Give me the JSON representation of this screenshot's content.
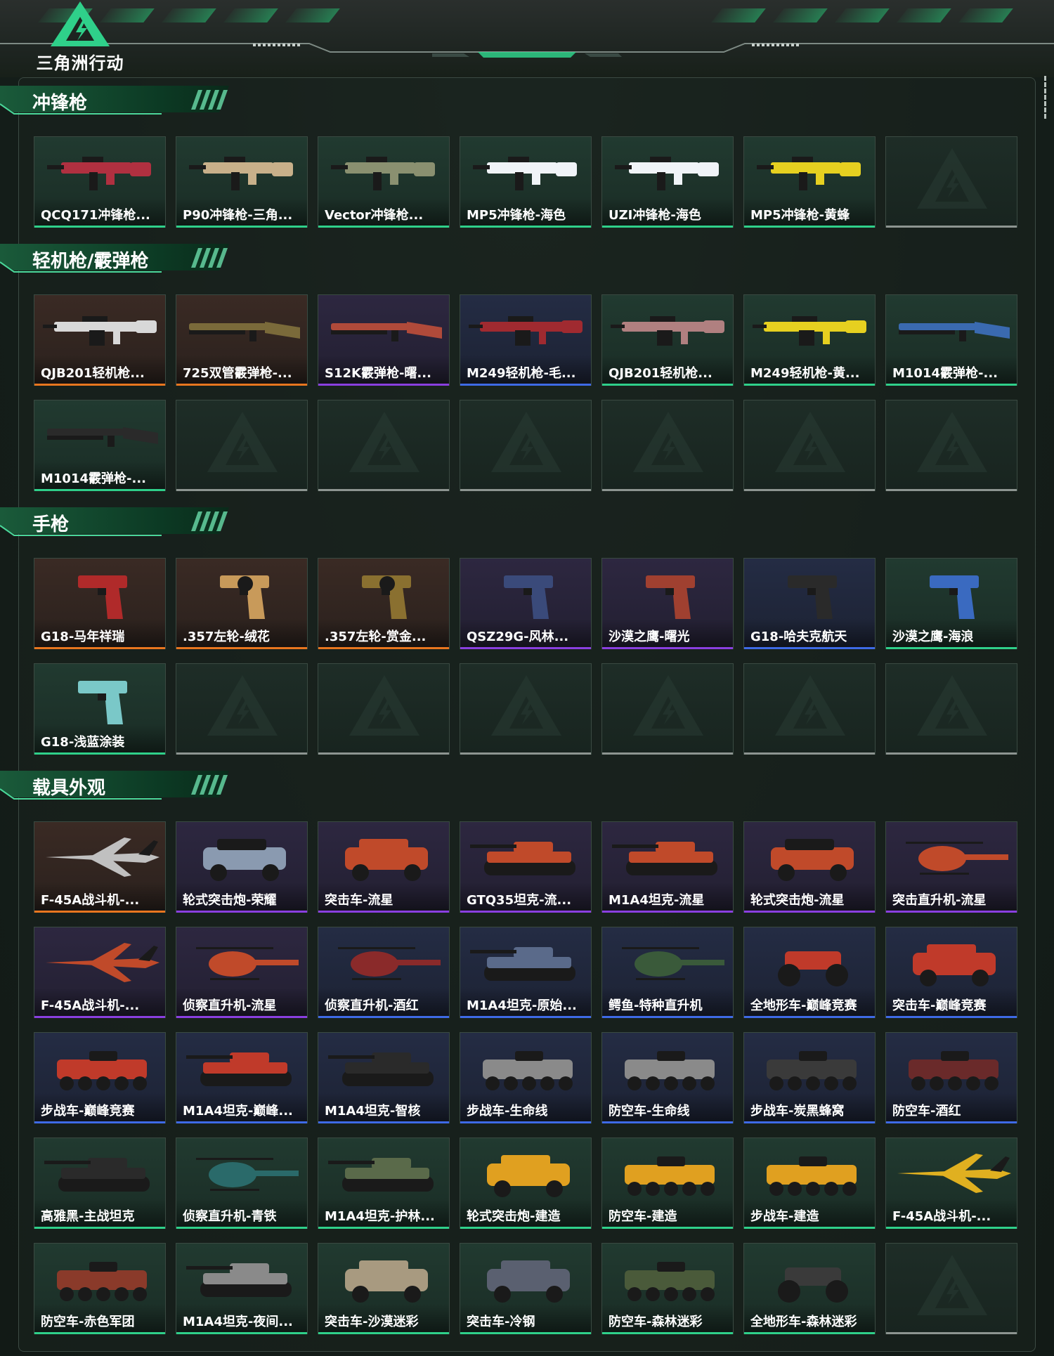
{
  "header": {
    "logo_text": "三角洲行动",
    "accent_color": "#2fd08a"
  },
  "quality_colors": {
    "green": "#2fd08a",
    "orange": "#e8761f",
    "purple": "#8a3fe0",
    "blue": "#3e6ae6",
    "empty": "#8d9591"
  },
  "sections": [
    {
      "title": "冲锋枪",
      "items": [
        {
          "label": "QCQ171冲锋枪...",
          "quality": "green",
          "icon": "smg-icon",
          "tint": "#b03040"
        },
        {
          "label": "P90冲锋枪-三角...",
          "quality": "green",
          "icon": "smg-icon",
          "tint": "#c8b08a"
        },
        {
          "label": "Vector冲锋枪...",
          "quality": "green",
          "icon": "smg-icon",
          "tint": "#8a9070"
        },
        {
          "label": "MP5冲锋枪-海色",
          "quality": "green",
          "icon": "smg-icon",
          "tint": "#f0f4f8"
        },
        {
          "label": "UZI冲锋枪-海色",
          "quality": "green",
          "icon": "smg-icon",
          "tint": "#f0f4f8"
        },
        {
          "label": "MP5冲锋枪-黄蜂",
          "quality": "green",
          "icon": "smg-icon",
          "tint": "#e6d020"
        },
        {
          "label": "",
          "quality": "empty",
          "icon": "",
          "tint": ""
        }
      ]
    },
    {
      "title": "轻机枪/霰弹枪",
      "items": [
        {
          "label": "QJB201轻机枪...",
          "quality": "orange",
          "icon": "lmg-icon",
          "tint": "#d8d8d8"
        },
        {
          "label": "725双管霰弹枪-...",
          "quality": "orange",
          "icon": "shotgun-icon",
          "tint": "#7a6a3a"
        },
        {
          "label": "S12K霰弹枪-曙...",
          "quality": "purple",
          "icon": "shotgun-icon",
          "tint": "#b04a3a"
        },
        {
          "label": "M249轻机枪-毛...",
          "quality": "blue",
          "icon": "lmg-icon",
          "tint": "#a02a30"
        },
        {
          "label": "QJB201轻机枪...",
          "quality": "green",
          "icon": "lmg-icon",
          "tint": "#b08080"
        },
        {
          "label": "M249轻机枪-黄...",
          "quality": "green",
          "icon": "lmg-icon",
          "tint": "#e6d020"
        },
        {
          "label": "M1014霰弹枪-...",
          "quality": "green",
          "icon": "shotgun-icon",
          "tint": "#3a6ab0"
        },
        {
          "label": "M1014霰弹枪-...",
          "quality": "green",
          "icon": "shotgun-icon",
          "tint": "#2a2a2a"
        },
        {
          "label": "",
          "quality": "empty",
          "icon": "",
          "tint": ""
        },
        {
          "label": "",
          "quality": "empty",
          "icon": "",
          "tint": ""
        },
        {
          "label": "",
          "quality": "empty",
          "icon": "",
          "tint": ""
        },
        {
          "label": "",
          "quality": "empty",
          "icon": "",
          "tint": ""
        },
        {
          "label": "",
          "quality": "empty",
          "icon": "",
          "tint": ""
        },
        {
          "label": "",
          "quality": "empty",
          "icon": "",
          "tint": ""
        }
      ]
    },
    {
      "title": "手枪",
      "items": [
        {
          "label": "G18-马年祥瑞",
          "quality": "orange",
          "icon": "pistol-icon",
          "tint": "#b02a2a"
        },
        {
          "label": ".357左轮-绒花",
          "quality": "orange",
          "icon": "revolver-icon",
          "tint": "#c89a5a"
        },
        {
          "label": ".357左轮-赏金...",
          "quality": "orange",
          "icon": "revolver-icon",
          "tint": "#8a7030"
        },
        {
          "label": "QSZ29G-风林...",
          "quality": "purple",
          "icon": "pistol-icon",
          "tint": "#3a4a7a"
        },
        {
          "label": "沙漠之鹰-曙光",
          "quality": "purple",
          "icon": "pistol-icon",
          "tint": "#a04030"
        },
        {
          "label": "G18-哈夫克航天",
          "quality": "blue",
          "icon": "pistol-icon",
          "tint": "#2a2a2a"
        },
        {
          "label": "沙漠之鹰-海浪",
          "quality": "green",
          "icon": "pistol-icon",
          "tint": "#3a6ac0"
        },
        {
          "label": "G18-浅蓝涂装",
          "quality": "green",
          "icon": "pistol-icon",
          "tint": "#7ac8c8"
        },
        {
          "label": "",
          "quality": "empty",
          "icon": "",
          "tint": ""
        },
        {
          "label": "",
          "quality": "empty",
          "icon": "",
          "tint": ""
        },
        {
          "label": "",
          "quality": "empty",
          "icon": "",
          "tint": ""
        },
        {
          "label": "",
          "quality": "empty",
          "icon": "",
          "tint": ""
        },
        {
          "label": "",
          "quality": "empty",
          "icon": "",
          "tint": ""
        },
        {
          "label": "",
          "quality": "empty",
          "icon": "",
          "tint": ""
        }
      ]
    },
    {
      "title": "载具外观",
      "items": [
        {
          "label": "F-45A战斗机-...",
          "quality": "orange",
          "icon": "jet-icon",
          "tint": "#c0c0c0"
        },
        {
          "label": "轮式突击炮-荣耀",
          "quality": "purple",
          "icon": "buggy-icon",
          "tint": "#8a9ab0"
        },
        {
          "label": "突击车-流星",
          "quality": "purple",
          "icon": "suv-icon",
          "tint": "#c04a2a"
        },
        {
          "label": "GTQ35坦克-流...",
          "quality": "purple",
          "icon": "tank-icon",
          "tint": "#c04a2a"
        },
        {
          "label": "M1A4坦克-流星",
          "quality": "purple",
          "icon": "tank-icon",
          "tint": "#c04a2a"
        },
        {
          "label": "轮式突击炮-流星",
          "quality": "purple",
          "icon": "buggy-icon",
          "tint": "#c04a2a"
        },
        {
          "label": "突击直升机-流星",
          "quality": "purple",
          "icon": "helicopter-icon",
          "tint": "#c04a2a"
        },
        {
          "label": "F-45A战斗机-...",
          "quality": "purple",
          "icon": "jet-icon",
          "tint": "#c04a2a"
        },
        {
          "label": "侦察直升机-流星",
          "quality": "purple",
          "icon": "helicopter-icon",
          "tint": "#c04a2a"
        },
        {
          "label": "侦察直升机-酒红",
          "quality": "blue",
          "icon": "helicopter-icon",
          "tint": "#8a2a2a"
        },
        {
          "label": "M1A4坦克-原始...",
          "quality": "blue",
          "icon": "tank-icon",
          "tint": "#5a6a8a"
        },
        {
          "label": "鳄鱼-特种直升机",
          "quality": "blue",
          "icon": "helicopter-icon",
          "tint": "#3a5a3a"
        },
        {
          "label": "全地形车-巅峰竞赛",
          "quality": "blue",
          "icon": "atv-icon",
          "tint": "#c03a2a"
        },
        {
          "label": "突击车-巅峰竞赛",
          "quality": "blue",
          "icon": "suv-icon",
          "tint": "#c03a2a"
        },
        {
          "label": "步战车-巅峰竞赛",
          "quality": "blue",
          "icon": "apc-icon",
          "tint": "#c03a2a"
        },
        {
          "label": "M1A4坦克-巅峰...",
          "quality": "blue",
          "icon": "tank-icon",
          "tint": "#c03a2a"
        },
        {
          "label": "M1A4坦克-智核",
          "quality": "blue",
          "icon": "tank-icon",
          "tint": "#2a2a2a"
        },
        {
          "label": "步战车-生命线",
          "quality": "blue",
          "icon": "apc-icon",
          "tint": "#8a8a8a"
        },
        {
          "label": "防空车-生命线",
          "quality": "blue",
          "icon": "apc-icon",
          "tint": "#8a8a8a"
        },
        {
          "label": "步战车-炭黑蜂窝",
          "quality": "blue",
          "icon": "apc-icon",
          "tint": "#3a3a3a"
        },
        {
          "label": "防空车-酒红",
          "quality": "blue",
          "icon": "apc-icon",
          "tint": "#6a2a2a"
        },
        {
          "label": "高雅黑-主战坦克",
          "quality": "green",
          "icon": "tank-icon",
          "tint": "#2a2a2a"
        },
        {
          "label": "侦察直升机-青铁",
          "quality": "green",
          "icon": "helicopter-icon",
          "tint": "#2a6a6a"
        },
        {
          "label": "M1A4坦克-护林...",
          "quality": "green",
          "icon": "tank-icon",
          "tint": "#5a6a4a"
        },
        {
          "label": "轮式突击炮-建造",
          "quality": "green",
          "icon": "suv-icon",
          "tint": "#e0a020"
        },
        {
          "label": "防空车-建造",
          "quality": "green",
          "icon": "apc-icon",
          "tint": "#e0a020"
        },
        {
          "label": "步战车-建造",
          "quality": "green",
          "icon": "apc-icon",
          "tint": "#e0a020"
        },
        {
          "label": "F-45A战斗机-...",
          "quality": "green",
          "icon": "jet-icon",
          "tint": "#e0b020"
        },
        {
          "label": "防空车-赤色军团",
          "quality": "green",
          "icon": "apc-icon",
          "tint": "#8a3a2a"
        },
        {
          "label": "M1A4坦克-夜间...",
          "quality": "green",
          "icon": "tank-icon",
          "tint": "#8a8a8a"
        },
        {
          "label": "突击车-沙漠迷彩",
          "quality": "green",
          "icon": "suv-icon",
          "tint": "#a89a80"
        },
        {
          "label": "突击车-冷钢",
          "quality": "green",
          "icon": "suv-icon",
          "tint": "#5a6070"
        },
        {
          "label": "防空车-森林迷彩",
          "quality": "green",
          "icon": "apc-icon",
          "tint": "#4a5a3a"
        },
        {
          "label": "全地形车-森林迷彩",
          "quality": "green",
          "icon": "atv-icon",
          "tint": "#3a3a3a"
        },
        {
          "label": "",
          "quality": "empty",
          "icon": "",
          "tint": ""
        }
      ]
    }
  ]
}
